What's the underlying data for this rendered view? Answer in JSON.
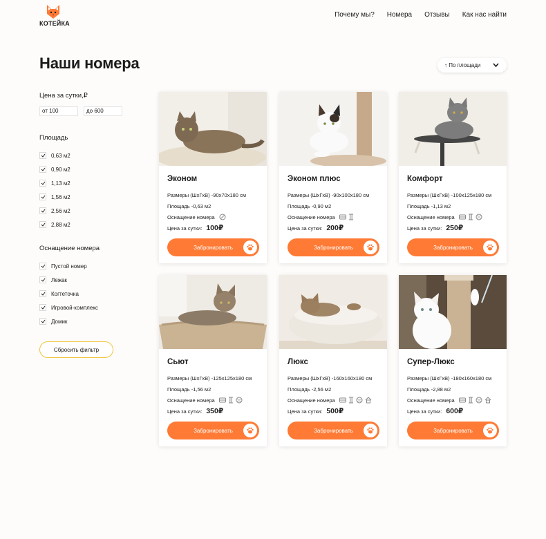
{
  "header": {
    "logo_text": "КОТЕЙКА",
    "nav": [
      "Почему мы?",
      "Номера",
      "Отзывы",
      "Как нас найти"
    ]
  },
  "page_title": "Наши номера",
  "sort": {
    "label": "↑ По площади"
  },
  "filters": {
    "price_title": "Цена за сутки,₽",
    "price_from": "от 100",
    "price_to": "до 600",
    "area_title": "Площадь",
    "areas": [
      "0,63 м2",
      "0,90 м2",
      "1,13 м2",
      "1,56 м2",
      "2,56 м2",
      "2,88 м2"
    ],
    "equip_title": "Оснащение номера",
    "equipment": [
      "Пустой номер",
      "Лежак",
      "Когтеточка",
      "Игровой-комплекс",
      "Домик"
    ],
    "reset_label": "Сбросить фильтр"
  },
  "colors": {
    "accent": "#fe7a35",
    "reset_border": "#f1c43e"
  },
  "labels": {
    "size_prefix": "Размеры (ШхГхВ) - ",
    "area_prefix": "Площадь - ",
    "equip_label": "Оснащение номера",
    "price_label": "Цена за сутки:",
    "book_label": "Забронировать"
  },
  "rooms": [
    {
      "name": "Эконом",
      "size": "90х70х180 см",
      "area": "0,63 м2",
      "icons": [
        "none-icon"
      ],
      "price": "100₽"
    },
    {
      "name": "Эконом плюс",
      "size": "90х100х180 см",
      "area": "0,90 м2",
      "icons": [
        "bed-icon",
        "scratching-post-icon"
      ],
      "price": "200₽"
    },
    {
      "name": "Комфорт",
      "size": "100х125х180 см",
      "area": "1,13 м2",
      "icons": [
        "bed-icon",
        "scratching-post-icon",
        "ball-icon"
      ],
      "price": "250₽"
    },
    {
      "name": "Сьют",
      "size": "125х125х180 см",
      "area": "1,56 м2",
      "icons": [
        "bed-icon",
        "scratching-post-icon",
        "ball-icon"
      ],
      "price": "350₽"
    },
    {
      "name": "Люкс",
      "size": "160х160х180 см",
      "area": "2,56 м2",
      "icons": [
        "bed-icon",
        "scratching-post-icon",
        "ball-icon",
        "house-icon"
      ],
      "price": "500₽"
    },
    {
      "name": "Супер-Люкс",
      "size": "180х160х180 см",
      "area": "2,88 м2",
      "icons": [
        "bed-icon",
        "scratching-post-icon",
        "ball-icon",
        "house-icon"
      ],
      "price": "600₽"
    }
  ]
}
